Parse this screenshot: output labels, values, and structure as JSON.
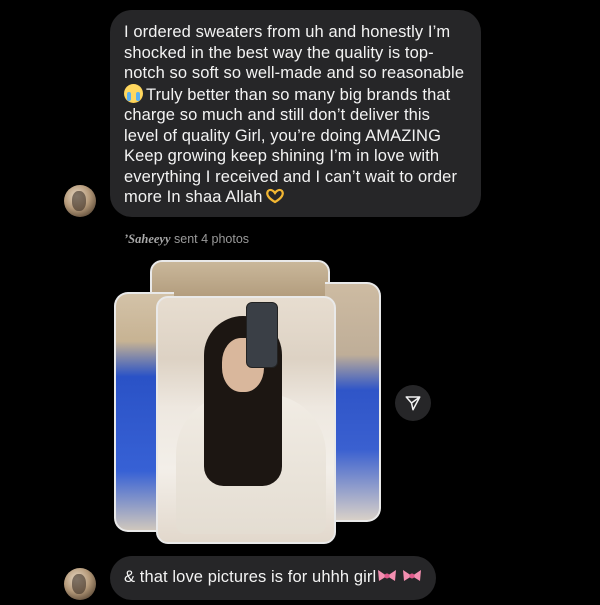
{
  "message1": {
    "lines": [
      "I ordered sweaters from uh and honestly I’m",
      "shocked in the best way the quality is top-",
      "notch so soft so well-made and so reasonable",
      "Truly better than so many big brands that",
      "charge so much and still don’t deliver this",
      "level of quality Girl, you’re doing AMAZING",
      "Keep growing keep shining I’m in love with",
      "everything I received and I can’t wait to order",
      "more In shaa Allah"
    ],
    "emoji_line4": "crying-face-emoji",
    "emoji_end": "heart-hands-emoji"
  },
  "photos": {
    "sender": "’Saheeyy",
    "action": " sent 4 photos",
    "count": 4
  },
  "message2": {
    "text": "& that love pictures is for uhhh girl",
    "emoji_end": "pink-bow-emoji"
  },
  "icons": {
    "share": "share-arrow-icon",
    "avatar": "user-avatar"
  },
  "colors": {
    "background": "#000000",
    "bubble": "#262628",
    "text": "#f3f3f3",
    "meta": "#9a9a9a"
  }
}
